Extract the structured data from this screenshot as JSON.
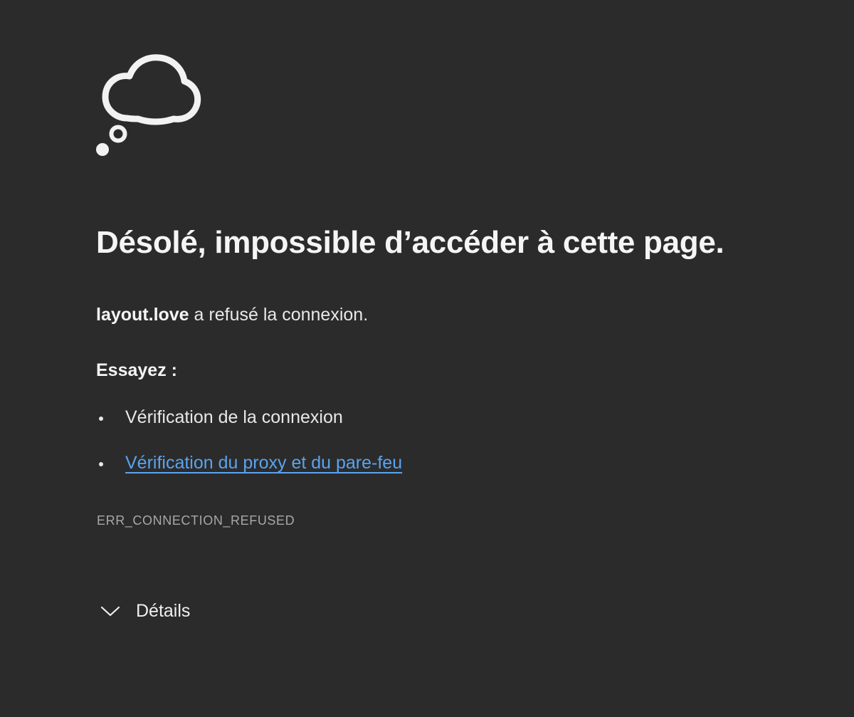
{
  "error_page": {
    "icon": "thought-cloud-icon",
    "title": "Désolé, impossible d’accéder à cette page.",
    "host": "layout.love",
    "message_suffix": " a refusé la connexion.",
    "try_heading": "Essayez :",
    "suggestions": [
      {
        "label": "Vérification de la connexion",
        "is_link": false
      },
      {
        "label": "Vérification du proxy et du pare-feu",
        "is_link": true
      }
    ],
    "error_code": "ERR_CONNECTION_REFUSED",
    "details_label": "Détails",
    "colors": {
      "background": "#2b2b2b",
      "text": "#f2f2f2",
      "link": "#5aa3ef",
      "muted": "#a8a8a8"
    }
  }
}
